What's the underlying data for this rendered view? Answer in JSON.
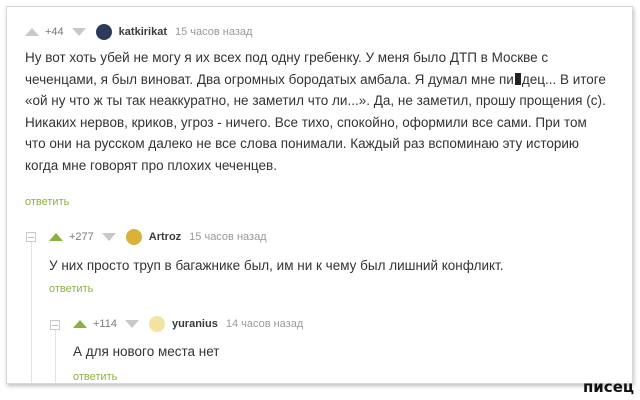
{
  "comments": [
    {
      "rating": "+44",
      "author": "katkirikat",
      "time": "15 часов назад",
      "text_before_censor": "Ну вот хоть убей не могу я их всех под одну гребенку. У меня было ДТП в Москве с чеченцами, я был виноват. Два огромных бородатых амбала. Я думал мне пи",
      "text_after_censor": "дец... В итоге «ой ну что ж ты так неаккуратно, не заметил что ли...». Да, не заметил, прошу прощения (с). Никаких нервов, криков, угроз - ничего. Все тихо, спокойно, оформили все сами. При том что они на русском далеко не все слова понимали. Каждый раз вспоминаю эту историю когда мне говорят про плохих чеченцев.",
      "reply_label": "ответить"
    },
    {
      "rating": "+277",
      "author": "Artroz",
      "time": "15 часов назад",
      "text": "У них просто труп в багажнике был, им ни к чему был лишний конфликт.",
      "reply_label": "ответить"
    },
    {
      "rating": "+114",
      "author": "yuranius",
      "time": "14 часов назад",
      "text": "А для нового места нет",
      "reply_label": "ответить"
    }
  ],
  "watermark": "писец",
  "colors": {
    "accent": "#8ab23c",
    "text": "#333333",
    "meta": "#9a9a9a"
  }
}
